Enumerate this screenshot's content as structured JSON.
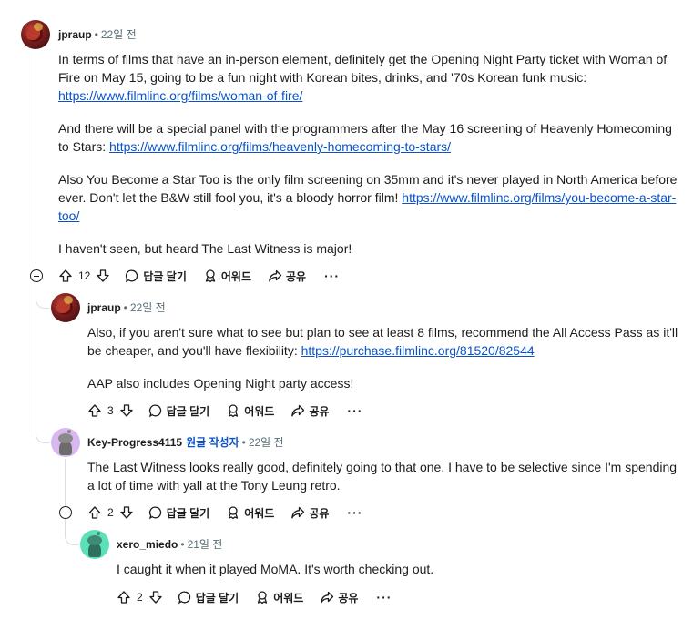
{
  "comments": [
    {
      "username": "jpraup",
      "time": "22일 전",
      "paragraphs": [
        {
          "text": "In terms of films that have an in-person element, definitely get the Opening Night Party ticket with Woman of Fire on May 15, going to be a fun night with Korean bites, drinks, and '70s Korean funk music: ",
          "link": "https://www.filmlinc.org/films/woman-of-fire/"
        },
        {
          "text": "And there will be a special panel with the programmers after the May 16 screening of Heavenly Homecoming to Stars: ",
          "link": "https://www.filmlinc.org/films/heavenly-homecoming-to-stars/"
        },
        {
          "text": "Also You Become a Star Too is the only film screening on 35mm and it's never played in North America before ever. Don't let the B&W still fool you, it's a bloody horror film! ",
          "link": "https://www.filmlinc.org/films/you-become-a-star-too/"
        },
        {
          "text": "I haven't seen, but heard The Last Witness is major!",
          "link": ""
        }
      ],
      "votes": "12"
    },
    {
      "username": "jpraup",
      "time": "22일 전",
      "paragraphs": [
        {
          "text": "Also, if you aren't sure what to see but plan to see at least 8 films, recommend the All Access Pass as it'll be cheaper, and you'll have flexibility: ",
          "link": "https://purchase.filmlinc.org/81520/82544"
        },
        {
          "text": "AAP also includes Opening Night party access!",
          "link": ""
        }
      ],
      "votes": "3"
    },
    {
      "username": "Key-Progress4115",
      "op_badge": "원글 작성자",
      "time": "22일 전",
      "paragraphs": [
        {
          "text": "The Last Witness looks really good, definitely going to that one. I have to be selective since I'm spending a lot of time with yall at the Tony Leung retro.",
          "link": ""
        }
      ],
      "votes": "2"
    },
    {
      "username": "xero_miedo",
      "time": "21일 전",
      "paragraphs": [
        {
          "text": "I caught it when it played MoMA. It's worth checking out.",
          "link": ""
        }
      ],
      "votes": "2"
    }
  ],
  "actions": {
    "reply": "답글 달기",
    "award": "어워드",
    "share": "공유",
    "more": "···"
  },
  "separator": "•",
  "colors": {
    "link": "#0a52c7",
    "op": "#0a52c7",
    "meta": "#576f76"
  }
}
